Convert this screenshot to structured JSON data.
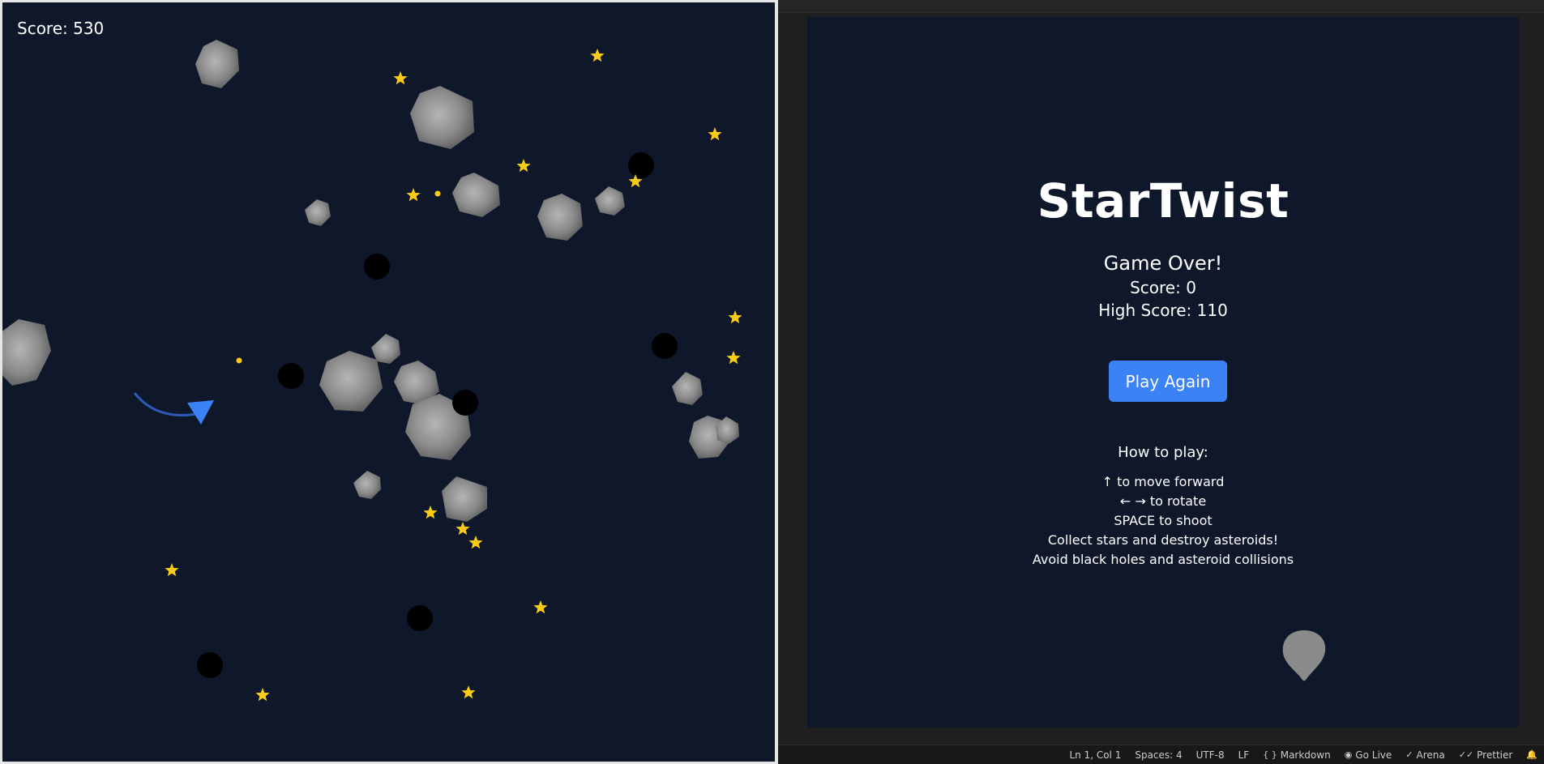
{
  "game": {
    "score_text": "Score: 530"
  },
  "preview": {
    "title": "StarTwist",
    "game_over": "Game Over!",
    "score": "Score: 0",
    "high_score": "High Score: 110",
    "play_again_label": "Play Again",
    "how_to_title": "How to play:",
    "instructions": [
      "↑ to move forward",
      "← → to rotate",
      "SPACE to shoot",
      "Collect stars and destroy asteroids!",
      "Avoid black holes and asteroid collisions"
    ]
  },
  "status_bar": {
    "position": "Ln 1, Col 1",
    "spaces": "Spaces: 4",
    "encoding": "UTF-8",
    "eol": "LF",
    "language": "Markdown",
    "go_live": "Go Live",
    "arena": "Arena",
    "prettier": "Prettier",
    "icons": {
      "language": "braces-icon",
      "go_live": "broadcast-icon",
      "arena": "check-icon",
      "prettier": "double-check-icon",
      "notifications": "bell-icon"
    }
  },
  "colors": {
    "canvas_bg": "#0f172a",
    "star": "#facc15",
    "ship": "#3b82f6",
    "asteroid": "#9ca3af",
    "black_hole": "#000000",
    "button": "#3b82f6"
  }
}
